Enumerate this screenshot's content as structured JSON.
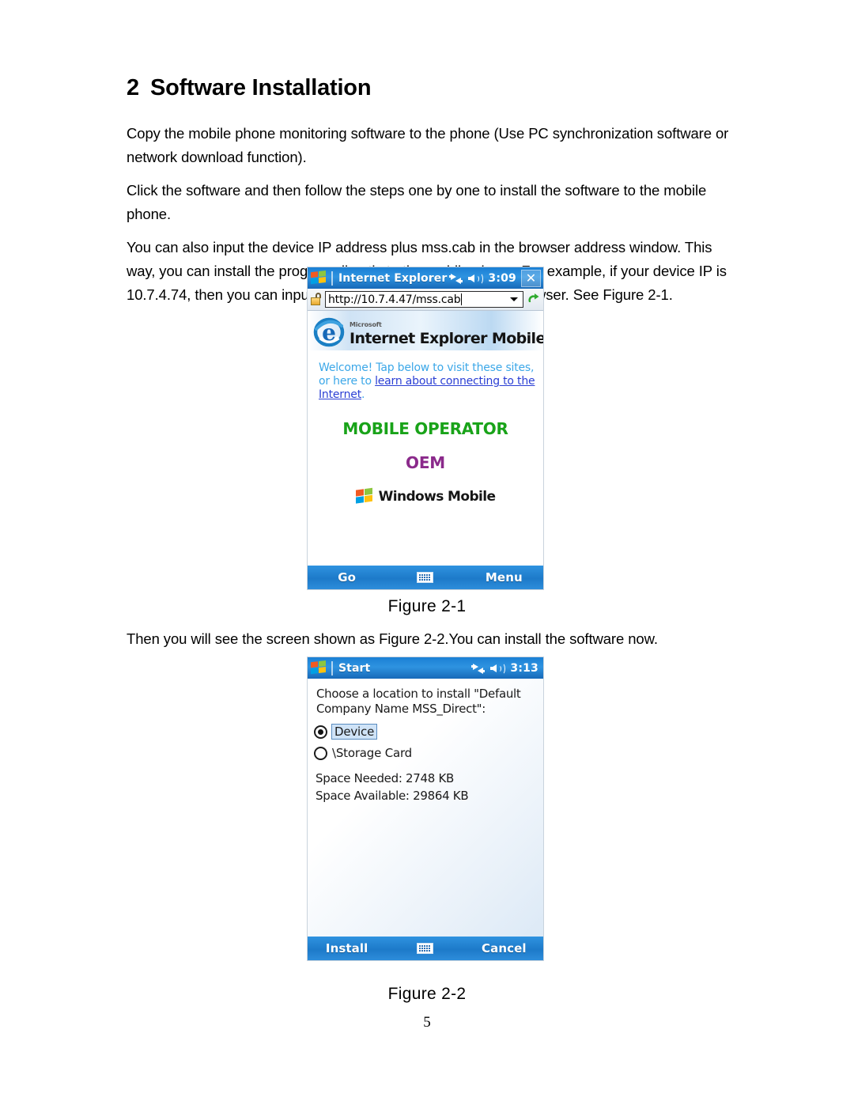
{
  "document": {
    "heading_number": "2",
    "heading_text": "Software Installation",
    "paragraphs": [
      "Copy the mobile phone monitoring software to the phone (Use PC synchronization software or network download function).",
      "Click the software and then follow the steps one by one to install the software to the mobile phone."
    ],
    "paragraph3": {
      "before": "You can also input the device IP address plus mss.cab in the browser address window. This way, you can install the program directly to the mobile phone. For example, if your device IP is 10.7.4.74, then you can input ",
      "link": "http://10.7.4.47/mss.cab",
      "after": " in the browser. See Figure 2-1."
    },
    "after_fig1_text": "Then you will see the screen shown as Figure 2-2.You can install the software now.",
    "figure1_caption": "Figure 2-1",
    "figure2_caption": "Figure 2-2",
    "page_number": "5",
    "link_color": "#19a319"
  },
  "figure1": {
    "titlebar": {
      "title": "Internet Explorer",
      "time": "3:09",
      "close_label": "✕",
      "connectivity_icon": "connectivity-icon",
      "speaker_icon": "speaker-icon",
      "start_flag_icon": "windows-flag-icon",
      "bg_color": "#1a7fd4"
    },
    "addressbar": {
      "lock_icon": "padlock-icon",
      "url": "http://10.7.4.47/mss.cab",
      "dropdown_icon": "chevron-down-icon",
      "refresh_icon": "refresh-go-icon"
    },
    "banner": {
      "vendor": "Microsoft",
      "product": "Internet Explorer Mobile",
      "logo_icon": "internet-explorer-e-icon"
    },
    "page": {
      "welcome_part1": "Welcome! Tap below to visit these sites, or here to ",
      "welcome_link1": "learn about connecting to the Internet",
      "welcome_part2": ".",
      "mobile_operator": "MOBILE OPERATOR",
      "mobile_operator_color": "#19a319",
      "oem": "OEM",
      "oem_color": "#8b2a8b",
      "windows_mobile": "Windows Mobile",
      "windows_mobile_icon": "windows-flag-icon"
    },
    "softbar": {
      "left": "Go",
      "keyboard_icon": "keyboard-icon",
      "right": "Menu"
    }
  },
  "figure2": {
    "titlebar": {
      "title": "Start",
      "time": "3:13",
      "connectivity_icon": "connectivity-icon",
      "speaker_icon": "speaker-icon",
      "start_flag_icon": "windows-flag-icon"
    },
    "dialog": {
      "prompt": "Choose a location to install \"Default Company Name MSS_Direct\":",
      "options": [
        {
          "label": "Device",
          "selected": true
        },
        {
          "label": "\\Storage Card",
          "selected": false
        }
      ],
      "space_needed": "Space Needed:  2748 KB",
      "space_available": "Space Available: 29864 KB"
    },
    "softbar": {
      "left": "Install",
      "keyboard_icon": "keyboard-icon",
      "right": "Cancel"
    }
  }
}
